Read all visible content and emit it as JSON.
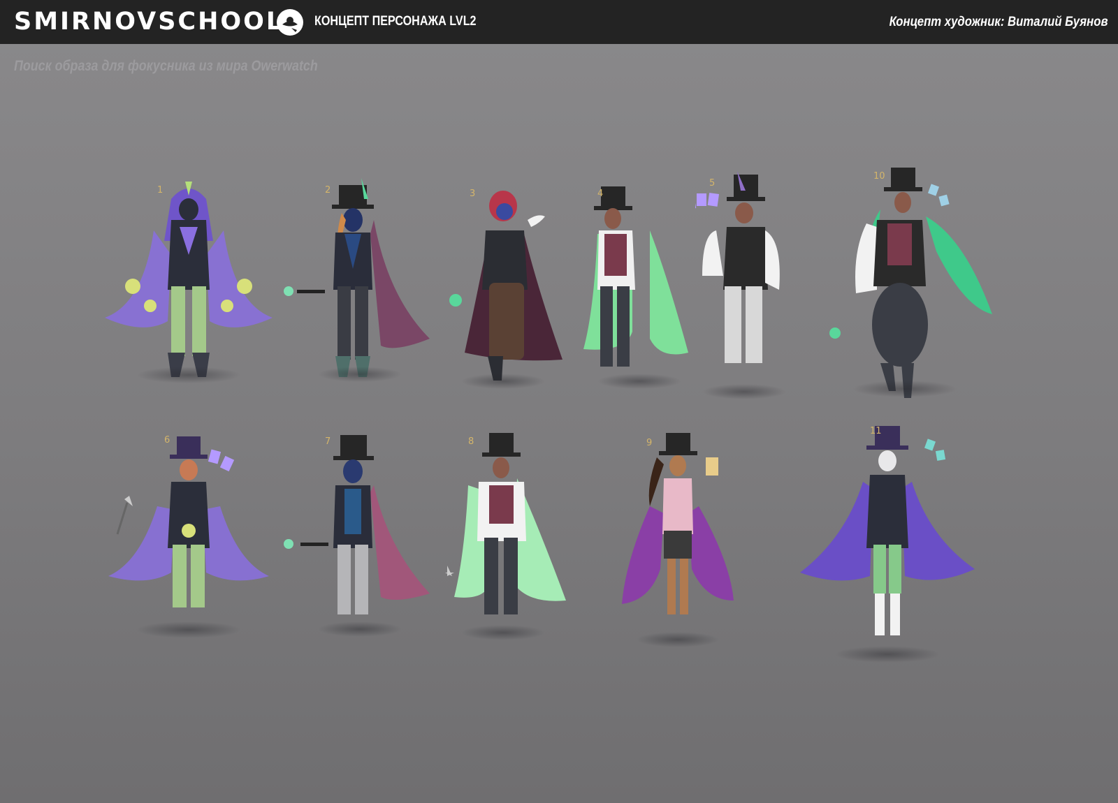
{
  "header": {
    "brand": "SMIRNOVSCHOOL",
    "course": "КОНЦЕПТ ПЕРСОНАЖА LVL2",
    "artist": "Концепт художник: Виталий Буянов",
    "logo_icon": "flying-saucer-icon"
  },
  "subtitle": "Поиск образа для фокусника из мира Owerwatch",
  "colors": {
    "header_bg": "#232323",
    "background": "#838284",
    "purple": "#7b5fd6",
    "green": "#6fdf93",
    "checker": "#a4c98a",
    "dark": "#2b2e3a"
  },
  "figures": [
    {
      "number": "1",
      "hat": "none",
      "cape": "#8a6fe0",
      "accent": "#b5e07a"
    },
    {
      "number": "2",
      "hat": "top-hat",
      "cape": "#7a4766",
      "accent": "#59d79b"
    },
    {
      "number": "3",
      "hat": "none",
      "cape": "#4a2638",
      "accent": "#59d79b"
    },
    {
      "number": "4",
      "hat": "top-hat",
      "cape": "#7fe09a",
      "accent": "#7a3a4c"
    },
    {
      "number": "5",
      "hat": "top-hat",
      "cape": "#9c7ad6",
      "accent": "#ffffff"
    },
    {
      "number": "10",
      "hat": "top-hat",
      "cape": "#3fc98a",
      "accent": "#7a3a4c"
    },
    {
      "number": "6",
      "hat": "top-hat",
      "cape": "#8a6fe0",
      "accent": "#b5e07a"
    },
    {
      "number": "7",
      "hat": "top-hat",
      "cape": "#a1577a",
      "accent": "#59d79b"
    },
    {
      "number": "8",
      "hat": "top-hat",
      "cape": "#a6ecb6",
      "accent": "#7a3a4c"
    },
    {
      "number": "9",
      "hat": "top-hat",
      "cape": "#8a3fa6",
      "accent": "#e8b9c8"
    },
    {
      "number": "11",
      "hat": "top-hat",
      "cape": "#6a4fc6",
      "accent": "#86c98a"
    }
  ]
}
